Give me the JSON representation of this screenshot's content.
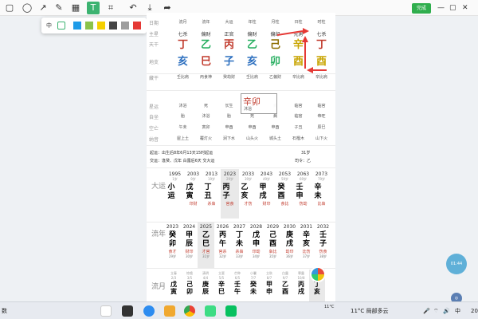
{
  "toolbar": {
    "tools": [
      "rect-tool",
      "ellipse-tool",
      "arrow-tool",
      "pen-tool",
      "mosaic-tool",
      "text-tool",
      "crop-tool",
      "undo",
      "save",
      "share"
    ],
    "done_label": "完成",
    "palette": {
      "size_label": "中",
      "colors": [
        "#1e9be8",
        "#8bc34a",
        "#f5d000",
        "#444444",
        "#9e9e9e",
        "#e53935"
      ]
    }
  },
  "chart": {
    "header_labels": [
      "日期",
      "主星",
      "天干",
      "地支",
      "藏干",
      "星运",
      "自坐",
      "空亡",
      "纳音"
    ],
    "columns": [
      {
        "title": "流月",
        "zhu": "七杀",
        "gan": "丁",
        "zhi": "亥",
        "cang": "壬比肩",
        "xing": "沐浴",
        "zizuo": "胎",
        "kong": "午未",
        "nayin": "屋上土",
        "gan_color": "#c0392b",
        "zhi_color": "#2c6fbf"
      },
      {
        "title": "流年",
        "zhu": "偏财",
        "gan": "乙",
        "zhi": "巳",
        "cang": "丙食神",
        "xing": "死",
        "zizuo": "沐浴",
        "kong": "寅卯",
        "nayin": "覆灯火",
        "gan_color": "#27ae60",
        "zhi_color": "#c0392b"
      },
      {
        "title": "大运",
        "zhu": "正官",
        "gan": "丙",
        "zhi": "子",
        "cang": "癸劫财",
        "xing": "长生",
        "zizuo": "胎",
        "kong": "申酉",
        "nayin": "涧下水",
        "gan_color": "#c0392b",
        "zhi_color": "#2c6fbf"
      },
      {
        "title": "年柱",
        "zhu": "偏财",
        "gan": "乙",
        "zhi": "亥",
        "cang": "壬比肩",
        "xing": "死",
        "zizuo": "死",
        "kong": "申酉",
        "nayin": "山头火",
        "gan_color": "#27ae60",
        "zhi_color": "#2c6fbf"
      },
      {
        "title": "月柱",
        "zhu": "偏印",
        "gan": "己",
        "zhi": "卯",
        "cang": "乙偏财",
        "xing": "病",
        "zizuo": "病",
        "kong": "申酉",
        "nayin": "城头土",
        "gan_color": "#8d6e00",
        "zhi_color": "#27ae60"
      },
      {
        "title": "日柱",
        "zhu": "元男",
        "gan": "辛",
        "zhi": "酉",
        "cang": "辛比肩",
        "xing": "临官",
        "zizuo": "临官",
        "kong": "子丑",
        "nayin": "石榴木",
        "gan_color": "#c8a400",
        "zhi_color": "#c8a400"
      },
      {
        "title": "时柱",
        "zhu": "七杀",
        "gan": "丁",
        "zhi": "酉",
        "cang": "辛比肩",
        "xing": "临官",
        "zizuo": "帝旺",
        "kong": "辰巳",
        "nayin": "山下火",
        "gan_color": "#c0392b",
        "zhi_color": "#c8a400"
      }
    ]
  },
  "annotation": {
    "main": "辛卯",
    "sub": "沐浴"
  },
  "info": {
    "line1": "起运：出生后8年6月13天15时起运",
    "line2": "交运：逢癸、戊年 白露后6天 交大运",
    "age": "31岁",
    "siling": "司令：乙"
  },
  "dayun": {
    "label": "大运",
    "cols": [
      {
        "year": "1995",
        "age": "1岁",
        "gz": "小运",
        "god": "",
        "foot": ""
      },
      {
        "year": "2003",
        "age": "9岁",
        "gz": "戊寅",
        "god": "印财",
        "foot": ""
      },
      {
        "year": "2013",
        "age": "19岁",
        "gz": "丁丑",
        "god": "杀枭",
        "foot": ""
      },
      {
        "year": "2023",
        "age": "29岁",
        "gz": "丙子",
        "god": "官食",
        "foot": ""
      },
      {
        "year": "2033",
        "age": "39岁",
        "gz": "乙亥",
        "god": "才伤",
        "foot": ""
      },
      {
        "year": "2043",
        "age": "49岁",
        "gz": "甲戌",
        "god": "财印",
        "foot": ""
      },
      {
        "year": "2053",
        "age": "59岁",
        "gz": "癸酉",
        "god": "食比",
        "foot": ""
      },
      {
        "year": "2063",
        "age": "69岁",
        "gz": "壬申",
        "god": "伤劫",
        "foot": ""
      },
      {
        "year": "2073",
        "age": "79岁",
        "gz": "辛未",
        "god": "比枭",
        "foot": ""
      }
    ]
  },
  "liunian": {
    "label": "流年",
    "cols": [
      {
        "year": "2023",
        "gz": "癸卯",
        "god": "食才",
        "foot": "29岁"
      },
      {
        "year": "2024",
        "gz": "甲辰",
        "god": "财印",
        "foot": "30岁"
      },
      {
        "year": "2025",
        "gz": "乙巳",
        "god": "才官",
        "foot": "31岁"
      },
      {
        "year": "2026",
        "gz": "丙午",
        "god": "官杀",
        "foot": "32岁"
      },
      {
        "year": "2027",
        "gz": "丁未",
        "god": "杀枭",
        "foot": "33岁"
      },
      {
        "year": "2028",
        "gz": "戊申",
        "god": "印劫",
        "foot": "34岁"
      },
      {
        "year": "2029",
        "gz": "己酉",
        "god": "枭比",
        "foot": "35岁"
      },
      {
        "year": "2030",
        "gz": "庚戌",
        "god": "劫印",
        "foot": "36岁"
      },
      {
        "year": "2031",
        "gz": "辛亥",
        "god": "比伤",
        "foot": "37岁"
      },
      {
        "year": "2032",
        "gz": "壬子",
        "god": "伤食",
        "foot": "38岁"
      }
    ]
  },
  "liuyue": {
    "label": "流月",
    "cols": [
      {
        "term": "立春",
        "date": "2/3",
        "gz": "戊寅"
      },
      {
        "term": "惊蛰",
        "date": "3/5",
        "gz": "己卯"
      },
      {
        "term": "清明",
        "date": "4/4",
        "gz": "庚辰"
      },
      {
        "term": "立夏",
        "date": "5/5",
        "gz": "辛巳"
      },
      {
        "term": "芒种",
        "date": "6/5",
        "gz": "壬午"
      },
      {
        "term": "小暑",
        "date": "7/7",
        "gz": "癸未"
      },
      {
        "term": "立秋",
        "date": "8/7",
        "gz": "甲申"
      },
      {
        "term": "白露",
        "date": "9/7",
        "gz": "乙酉"
      },
      {
        "term": "寒露",
        "date": "10/8",
        "gz": "丙戌"
      },
      {
        "term": "立冬",
        "date": "11/7",
        "gz": "丁亥"
      }
    ]
  },
  "float_badge": "01:44",
  "taskbar": {
    "left_text": "数",
    "weather": "11°C 局部多云",
    "temp_small": "11°C",
    "ime": "中",
    "time": "20"
  }
}
